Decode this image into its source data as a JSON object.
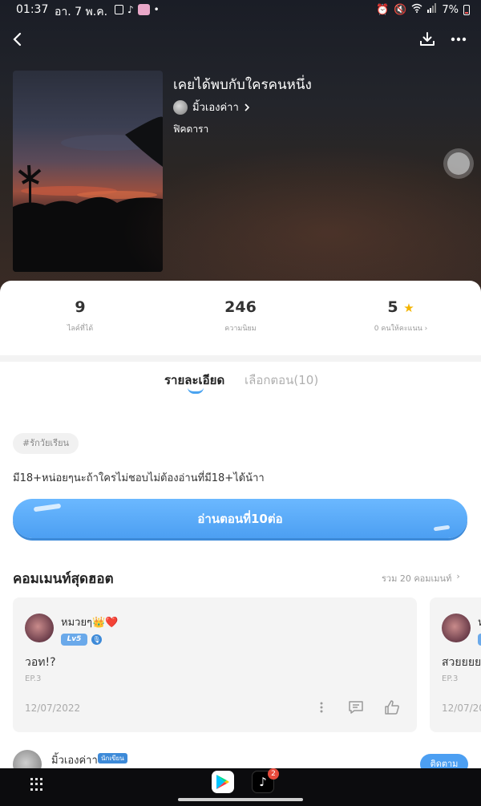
{
  "status_bar": {
    "time": "01:37",
    "date": "อา. 7 พ.ค.",
    "battery": "7%"
  },
  "story": {
    "title": "เคยได้พบกับใครคนหนึ่ง",
    "author": "มิ้วเองค่าา",
    "genre": "ฟิคดารา"
  },
  "stats": [
    {
      "value": "9",
      "label": "ไลค์ที่ได้"
    },
    {
      "value": "246",
      "label": "ความนิยม"
    },
    {
      "value": "5",
      "label": "0 คนให้คะแนน"
    }
  ],
  "tabs": {
    "details": "รายละเอียด",
    "episodes": "เลือกตอน(10)"
  },
  "tag": "#รักวัยเรียน",
  "description": "มี18+หน่อยๆนะถ้าใครไม่ชอบไม่ต้องอ่านที่มี18+ได้น้าา",
  "read_button": "อ่านตอนที่10ต่อ",
  "comments_section": {
    "title": "คอมเมนท์สุดฮอต",
    "total": "รวม 20 คอมเมนท์"
  },
  "comments": [
    {
      "name": "หมวยๆ👑❤️",
      "level": "Lv5",
      "text": "วอท!?",
      "episode": "EP.3",
      "date": "12/07/2022"
    },
    {
      "name": "ห",
      "level": "",
      "text": "สวยยยย",
      "episode": "EP.3",
      "date": "12/07/20"
    }
  ],
  "author_strip": {
    "name": "มิ้วเองค่าา",
    "badge": "นักเขียน",
    "follow": "ติดตาม"
  },
  "nav": {
    "tiktok_badge": "2"
  },
  "colors": {
    "accent": "#4c9ff2",
    "star": "#f4b400"
  }
}
